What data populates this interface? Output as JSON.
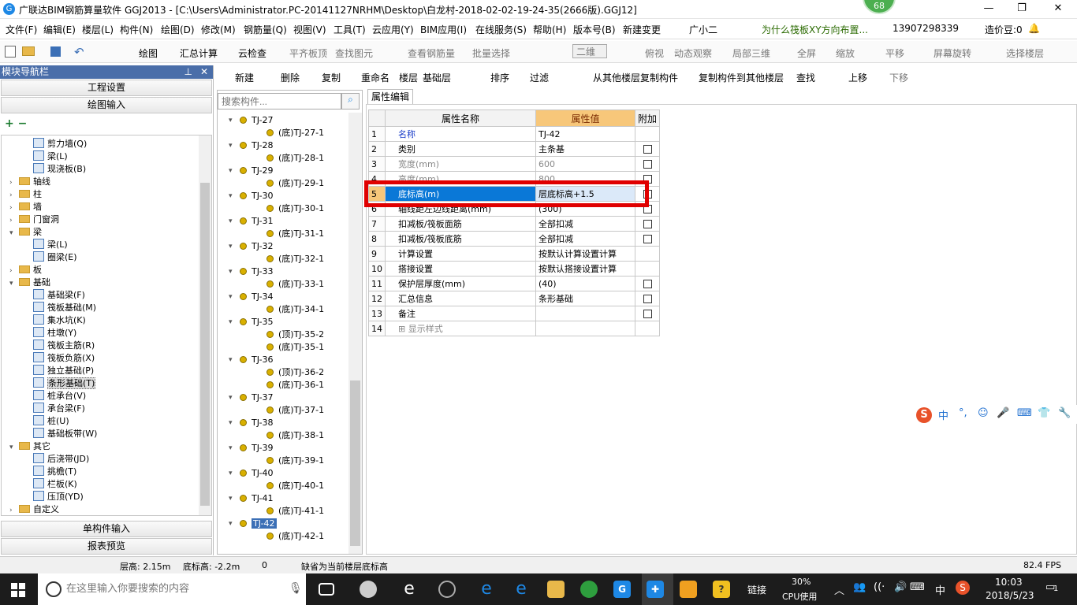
{
  "titlebar": {
    "title": "广联达BIM钢筋算量软件 GGJ2013 - [C:\\Users\\Administrator.PC-20141127NRHM\\Desktop\\白龙村-2018-02-02-19-24-35(2666版).GGJ12]",
    "badge": "68"
  },
  "menu": [
    "文件(F)",
    "编辑(E)",
    "楼层(L)",
    "构件(N)",
    "绘图(D)",
    "修改(M)",
    "钢筋量(Q)",
    "视图(V)",
    "工具(T)",
    "云应用(Y)",
    "BIM应用(I)",
    "在线服务(S)",
    "帮助(H)",
    "版本号(B)",
    "新建变更",
    "广小二",
    "为什么筏板XY方向布置...",
    "13907298339",
    "造价豆:0"
  ],
  "toolbar1": [
    "绘图",
    "汇总计算",
    "云检查",
    "平齐板顶",
    "查找图元",
    "查看钢筋量",
    "批量选择",
    "二维",
    "俯视",
    "动态观察",
    "局部三维",
    "全屏",
    "缩放",
    "平移",
    "屏幕旋转",
    "选择楼层"
  ],
  "leftpanel": {
    "header": "模块导航栏",
    "btn_project": "工程设置",
    "btn_draw": "绘图输入",
    "btn_single": "单构件输入",
    "btn_report": "报表预览",
    "tree": [
      {
        "label": "剪力墙(Q)",
        "level": 2,
        "type": "item"
      },
      {
        "label": "梁(L)",
        "level": 2,
        "type": "item"
      },
      {
        "label": "现浇板(B)",
        "level": 2,
        "type": "item"
      },
      {
        "label": "轴线",
        "level": 0,
        "type": "folder",
        "exp": "+"
      },
      {
        "label": "柱",
        "level": 0,
        "type": "folder",
        "exp": "+"
      },
      {
        "label": "墙",
        "level": 0,
        "type": "folder",
        "exp": "+"
      },
      {
        "label": "门窗洞",
        "level": 0,
        "type": "folder",
        "exp": "+"
      },
      {
        "label": "梁",
        "level": 0,
        "type": "folder",
        "exp": "-"
      },
      {
        "label": "梁(L)",
        "level": 2,
        "type": "item"
      },
      {
        "label": "圈梁(E)",
        "level": 2,
        "type": "item"
      },
      {
        "label": "板",
        "level": 0,
        "type": "folder",
        "exp": "+"
      },
      {
        "label": "基础",
        "level": 0,
        "type": "folder",
        "exp": "-"
      },
      {
        "label": "基础梁(F)",
        "level": 2,
        "type": "item"
      },
      {
        "label": "筏板基础(M)",
        "level": 2,
        "type": "item"
      },
      {
        "label": "集水坑(K)",
        "level": 2,
        "type": "item"
      },
      {
        "label": "柱墩(Y)",
        "level": 2,
        "type": "item"
      },
      {
        "label": "筏板主筋(R)",
        "level": 2,
        "type": "item"
      },
      {
        "label": "筏板负筋(X)",
        "level": 2,
        "type": "item"
      },
      {
        "label": "独立基础(P)",
        "level": 2,
        "type": "item"
      },
      {
        "label": "条形基础(T)",
        "level": 2,
        "type": "item",
        "selected": true
      },
      {
        "label": "桩承台(V)",
        "level": 2,
        "type": "item"
      },
      {
        "label": "承台梁(F)",
        "level": 2,
        "type": "item"
      },
      {
        "label": "桩(U)",
        "level": 2,
        "type": "item"
      },
      {
        "label": "基础板带(W)",
        "level": 2,
        "type": "item"
      },
      {
        "label": "其它",
        "level": 0,
        "type": "folder",
        "exp": "-"
      },
      {
        "label": "后浇带(JD)",
        "level": 2,
        "type": "item"
      },
      {
        "label": "挑檐(T)",
        "level": 2,
        "type": "item"
      },
      {
        "label": "栏板(K)",
        "level": 2,
        "type": "item"
      },
      {
        "label": "压顶(YD)",
        "level": 2,
        "type": "item"
      },
      {
        "label": "自定义",
        "level": 0,
        "type": "folder",
        "exp": "+"
      }
    ]
  },
  "toolbar2": [
    "新建",
    "删除",
    "复制",
    "重命名",
    "楼层",
    "基础层",
    "排序",
    "过滤",
    "从其他楼层复制构件",
    "复制构件到其他楼层",
    "查找",
    "上移",
    "下移"
  ],
  "components": {
    "search_placeholder": "搜索构件...",
    "items": [
      {
        "label": "TJ-27",
        "level": 0
      },
      {
        "label": "(底)TJ-27-1",
        "level": 1
      },
      {
        "label": "TJ-28",
        "level": 0
      },
      {
        "label": "(底)TJ-28-1",
        "level": 1
      },
      {
        "label": "TJ-29",
        "level": 0
      },
      {
        "label": "(底)TJ-29-1",
        "level": 1
      },
      {
        "label": "TJ-30",
        "level": 0
      },
      {
        "label": "(底)TJ-30-1",
        "level": 1
      },
      {
        "label": "TJ-31",
        "level": 0
      },
      {
        "label": "(底)TJ-31-1",
        "level": 1
      },
      {
        "label": "TJ-32",
        "level": 0
      },
      {
        "label": "(底)TJ-32-1",
        "level": 1
      },
      {
        "label": "TJ-33",
        "level": 0
      },
      {
        "label": "(底)TJ-33-1",
        "level": 1
      },
      {
        "label": "TJ-34",
        "level": 0
      },
      {
        "label": "(底)TJ-34-1",
        "level": 1
      },
      {
        "label": "TJ-35",
        "level": 0
      },
      {
        "label": "(顶)TJ-35-2",
        "level": 1
      },
      {
        "label": "(底)TJ-35-1",
        "level": 1
      },
      {
        "label": "TJ-36",
        "level": 0
      },
      {
        "label": "(顶)TJ-36-2",
        "level": 1
      },
      {
        "label": "(底)TJ-36-1",
        "level": 1
      },
      {
        "label": "TJ-37",
        "level": 0
      },
      {
        "label": "(底)TJ-37-1",
        "level": 1
      },
      {
        "label": "TJ-38",
        "level": 0
      },
      {
        "label": "(底)TJ-38-1",
        "level": 1
      },
      {
        "label": "TJ-39",
        "level": 0
      },
      {
        "label": "(底)TJ-39-1",
        "level": 1
      },
      {
        "label": "TJ-40",
        "level": 0
      },
      {
        "label": "(底)TJ-40-1",
        "level": 1
      },
      {
        "label": "TJ-41",
        "level": 0
      },
      {
        "label": "(底)TJ-41-1",
        "level": 1
      },
      {
        "label": "TJ-42",
        "level": 0,
        "selected": true
      },
      {
        "label": "(底)TJ-42-1",
        "level": 1
      }
    ]
  },
  "props": {
    "tab": "属性编辑",
    "headers": [
      "属性名称",
      "属性值",
      "附加"
    ],
    "rows": [
      {
        "n": "1",
        "name": "名称",
        "value": "TJ-42",
        "check": false,
        "blue": true
      },
      {
        "n": "2",
        "name": "类别",
        "value": "主条基",
        "check": true
      },
      {
        "n": "3",
        "name": "宽度(mm)",
        "value": "600",
        "check": true,
        "gray": true
      },
      {
        "n": "4",
        "name": "高度(mm)",
        "value": "800",
        "check": true,
        "gray": true
      },
      {
        "n": "5",
        "name": "底标高(m)",
        "value": "层底标高+1.5",
        "check": true,
        "selected": true
      },
      {
        "n": "6",
        "name": "轴线距左边线距离(mm)",
        "value": "(300)",
        "check": true
      },
      {
        "n": "7",
        "name": "扣减板/筏板面筋",
        "value": "全部扣减",
        "check": true
      },
      {
        "n": "8",
        "name": "扣减板/筏板底筋",
        "value": "全部扣减",
        "check": true
      },
      {
        "n": "9",
        "name": "计算设置",
        "value": "按默认计算设置计算",
        "check": false
      },
      {
        "n": "10",
        "name": "搭接设置",
        "value": "按默认搭接设置计算",
        "check": false
      },
      {
        "n": "11",
        "name": "保护层厚度(mm)",
        "value": "(40)",
        "check": true
      },
      {
        "n": "12",
        "name": "汇总信息",
        "value": "条形基础",
        "check": true
      },
      {
        "n": "13",
        "name": "备注",
        "value": "",
        "check": true
      },
      {
        "n": "14",
        "name": "显示样式",
        "value": "",
        "check": false,
        "gray": true,
        "plus": true
      }
    ]
  },
  "status": {
    "floor_h": "层高: 2.15m",
    "bottom": "底标高: -2.2m",
    "zero": "0",
    "hint": "缺省为当前楼层底标高",
    "fps": "82.4 FPS"
  },
  "taskbar": {
    "search": "在这里输入你要搜索的内容",
    "link": "链接",
    "cpu_pct": "30%",
    "cpu_label": "CPU使用",
    "ime": "中",
    "time": "10:03",
    "date": "2018/5/23",
    "notif": "1"
  },
  "ime_bar": [
    "中",
    "°,",
    "☺",
    "🎤",
    "⌨",
    "👕",
    "🔧"
  ]
}
